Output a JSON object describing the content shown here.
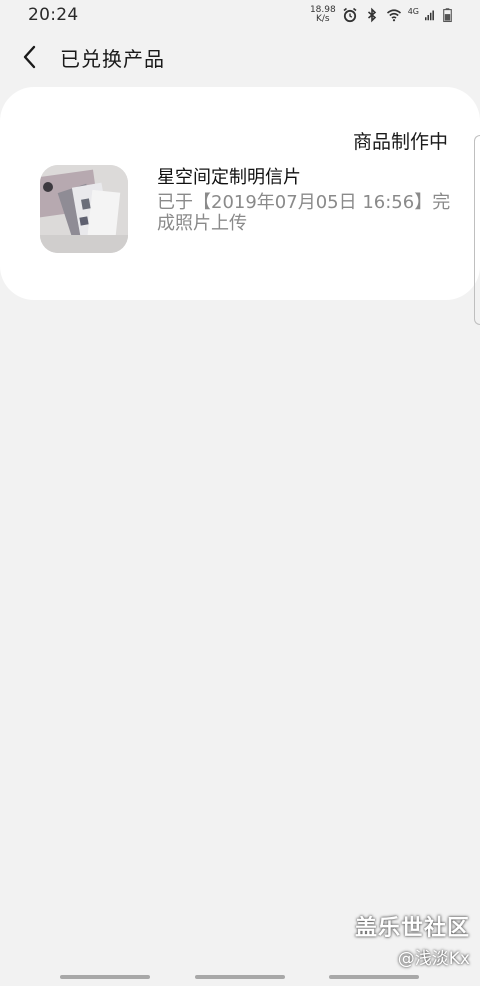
{
  "status_bar": {
    "time": "20:24",
    "speed_value": "18.98",
    "speed_unit": "K/s",
    "network": "4G",
    "icons": [
      "alarm-icon",
      "bluetooth-icon",
      "wifi-icon",
      "signal-icon",
      "battery-icon"
    ]
  },
  "header": {
    "back_icon": "chevron-left-icon",
    "title": "已兑换产品"
  },
  "product": {
    "status": "商品制作中",
    "name": "星空间定制明信片",
    "description": "已于【2019年07月05日 16:56】完成照片上传",
    "thumbnail": "postcard-photo"
  },
  "watermark": {
    "brand": "盖乐世社区",
    "user": "@浅淡Kx"
  },
  "colors": {
    "background": "#f2f2f2",
    "card": "#ffffff",
    "secondary_text": "#8a8a8a"
  }
}
